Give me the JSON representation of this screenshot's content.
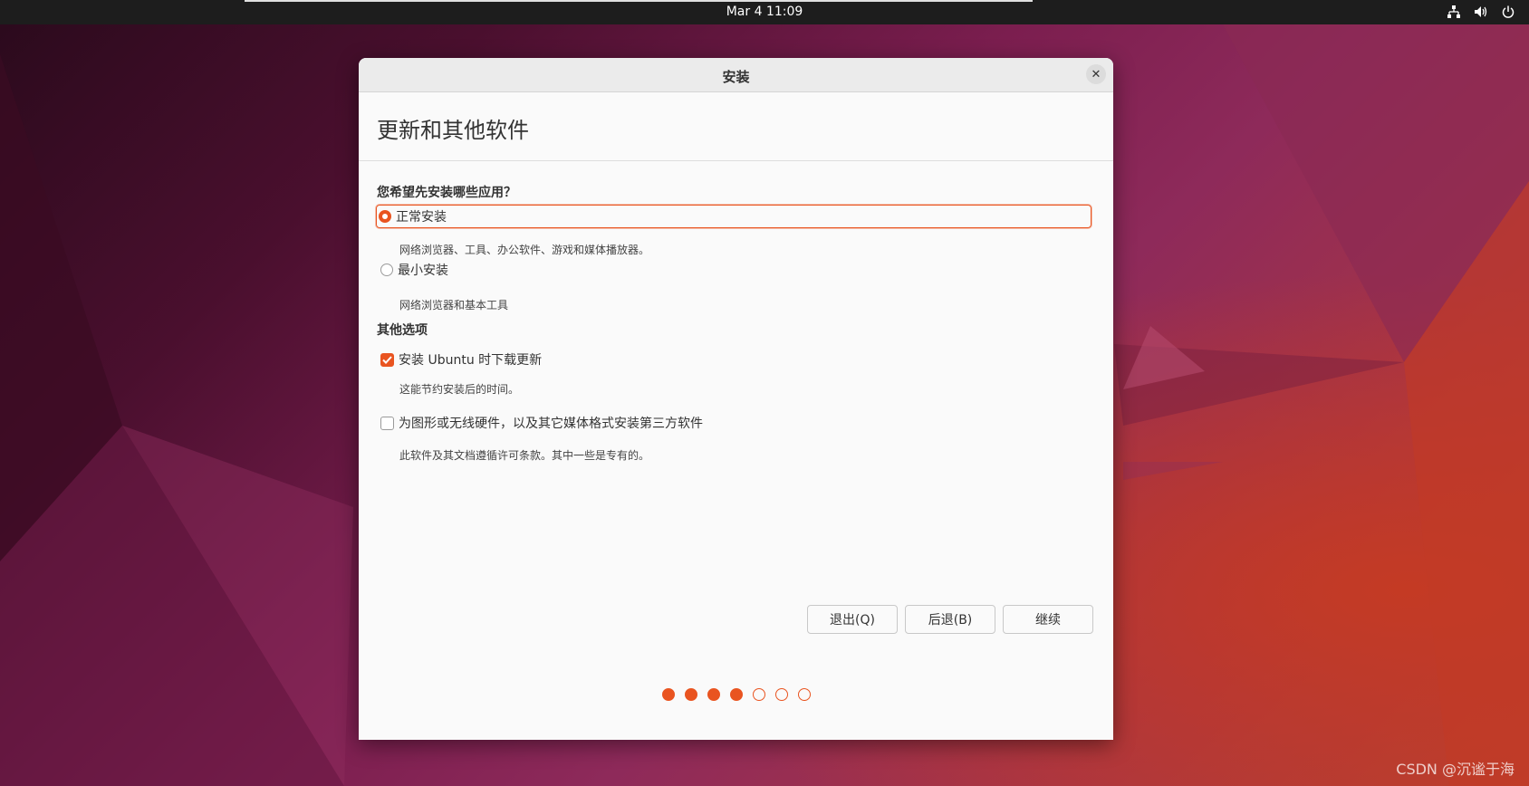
{
  "topbar": {
    "clock": "Mar 4  11:09",
    "tray_icons": [
      "network-icon",
      "volume-icon",
      "power-icon"
    ]
  },
  "window": {
    "title": "安装",
    "heading": "更新和其他软件",
    "install_section": {
      "label": "您希望先安装哪些应用？",
      "options": [
        {
          "label": "正常安装",
          "description": "网络浏览器、工具、办公软件、游戏和媒体播放器。",
          "selected": true
        },
        {
          "label": "最小安装",
          "description": "网络浏览器和基本工具",
          "selected": false
        }
      ]
    },
    "other_section": {
      "label": "其他选项",
      "options": [
        {
          "label": "安装 Ubuntu 时下载更新",
          "description": "这能节约安装后的时间。",
          "checked": true
        },
        {
          "label": "为图形或无线硬件，以及其它媒体格式安装第三方软件",
          "description": "此软件及其文档遵循许可条款。其中一些是专有的。",
          "checked": false
        }
      ]
    },
    "buttons": {
      "quit": "退出(Q)",
      "back": "后退(B)",
      "continue": "继续"
    },
    "progress": {
      "completed": 4,
      "total": 7
    }
  },
  "watermark": "CSDN @沉谧于海",
  "colors": {
    "accent": "#e95420",
    "topbar": "#1d1d1d",
    "window_bg": "#fafafa"
  }
}
